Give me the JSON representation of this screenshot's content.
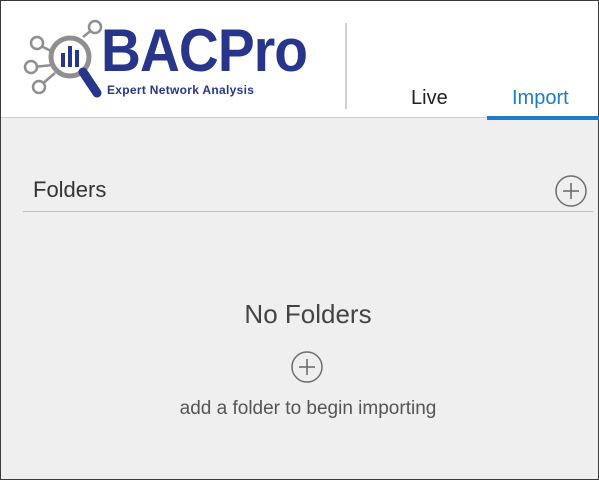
{
  "brand": {
    "name": "BACPro",
    "tagline": "Expert Network Analysis",
    "color": "#27368a",
    "icon": "network-magnifier-logo-icon"
  },
  "tabs": [
    {
      "label": "Live",
      "active": false
    },
    {
      "label": "Import",
      "active": true
    }
  ],
  "accent_color": "#1e7bc8",
  "folders": {
    "title": "Folders",
    "add_icon": "circle-plus-icon",
    "items": [],
    "empty": {
      "title": "No Folders",
      "hint": "add a folder to begin importing",
      "add_icon": "circle-plus-icon"
    }
  }
}
